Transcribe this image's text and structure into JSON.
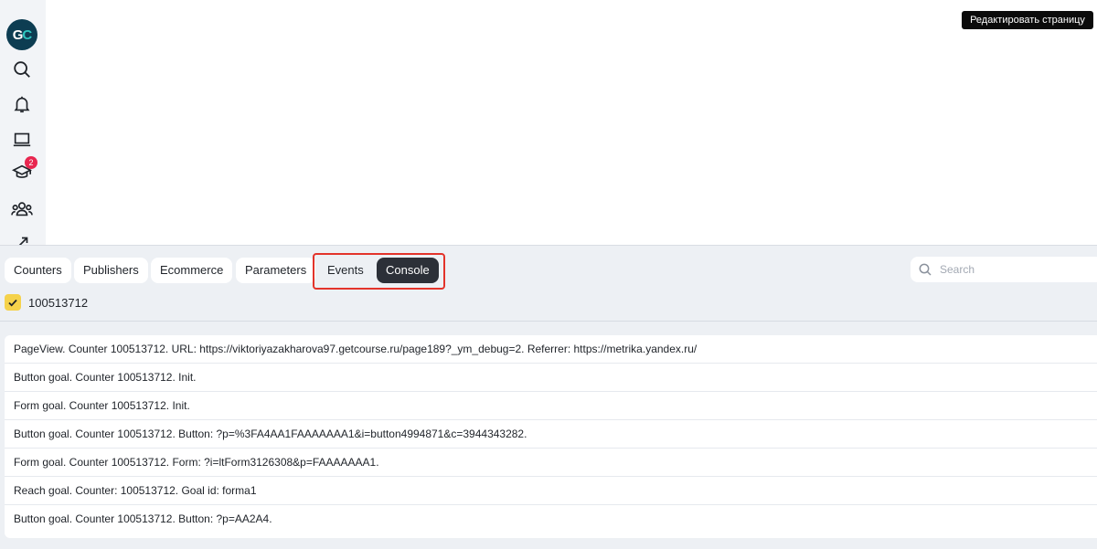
{
  "sidebar": {
    "logo": {
      "g": "G",
      "c": "C"
    },
    "icons": [
      "search-icon",
      "bell-icon",
      "laptop-icon",
      "graduation-cap-icon",
      "users-icon",
      "chart-icon"
    ],
    "notification_count": "2"
  },
  "header": {
    "edit_button_label": "Редактировать страницу"
  },
  "debug_panel": {
    "tabs": [
      {
        "label": "Counters",
        "active": false
      },
      {
        "label": "Publishers",
        "active": false
      },
      {
        "label": "Ecommerce",
        "active": false
      },
      {
        "label": "Parameters",
        "active": false
      },
      {
        "label": "Events",
        "active": false
      },
      {
        "label": "Console",
        "active": true
      }
    ],
    "search": {
      "placeholder": "Search",
      "value": ""
    },
    "counter": {
      "id": "100513712",
      "checked": true
    },
    "log": [
      "PageView. Counter 100513712. URL: https://viktoriyazakharova97.getcourse.ru/page189?_ym_debug=2. Referrer: https://metrika.yandex.ru/",
      "Button goal. Counter 100513712. Init.",
      "Form goal. Counter 100513712. Init.",
      "Button goal. Counter 100513712. Button: ?p=%3FA4AA1FAAAAAAA1&i=button4994871&c=3944343282.",
      "Form goal. Counter 100513712. Form: ?i=ltForm3126308&p=FAAAAAAA1.",
      "Reach goal. Counter: 100513712. Goal id: forma1",
      "Button goal. Counter 100513712. Button: ?p=AA2A4."
    ]
  },
  "colors": {
    "active_tab": "#2c3038",
    "highlight_border": "#e3332a",
    "checkbox": "#f5d24b",
    "badge": "#e8264f",
    "logo_bg": "#0d3d52"
  }
}
